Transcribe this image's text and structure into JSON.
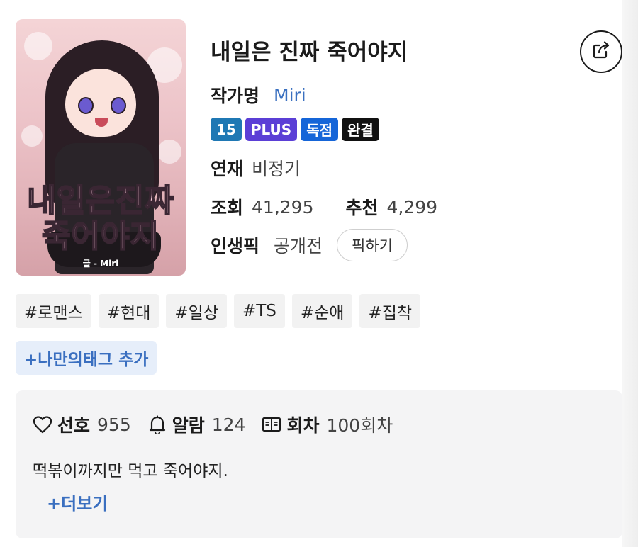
{
  "cover": {
    "title_line1": "내일은진짜",
    "title_line2": "죽어야지",
    "credit": "글 - Miri"
  },
  "title": "내일은 진짜 죽어야지",
  "author": {
    "label": "작가명",
    "name": "Miri"
  },
  "badges": [
    {
      "text": "15",
      "color": "#1f78b4"
    },
    {
      "text": "PLUS",
      "color": "#5b3fd6"
    },
    {
      "text": "독점",
      "color": "#1565d8"
    },
    {
      "text": "완결",
      "color": "#111111"
    }
  ],
  "serial": {
    "label": "연재",
    "value": "비정기"
  },
  "stats": {
    "views_label": "조회",
    "views": "41,295",
    "recommend_label": "추천",
    "recommend": "4,299"
  },
  "pick": {
    "label": "인생픽",
    "value": "공개전",
    "button": "픽하기"
  },
  "tags": [
    "#로맨스",
    "#현대",
    "#일상",
    "#TS",
    "#순애",
    "#집착"
  ],
  "add_tag_label": "+나만의태그 추가",
  "panel": {
    "favorite_label": "선호",
    "favorite": "955",
    "alarm_label": "알람",
    "alarm": "124",
    "episodes_label": "회차",
    "episodes": "100회차",
    "synopsis": "떡볶이까지만 먹고 죽어야지.",
    "more_label": "+더보기"
  },
  "icons": {
    "share": "share-icon",
    "favorite": "heart-icon",
    "alarm": "bell-icon",
    "episodes": "book-icon"
  }
}
